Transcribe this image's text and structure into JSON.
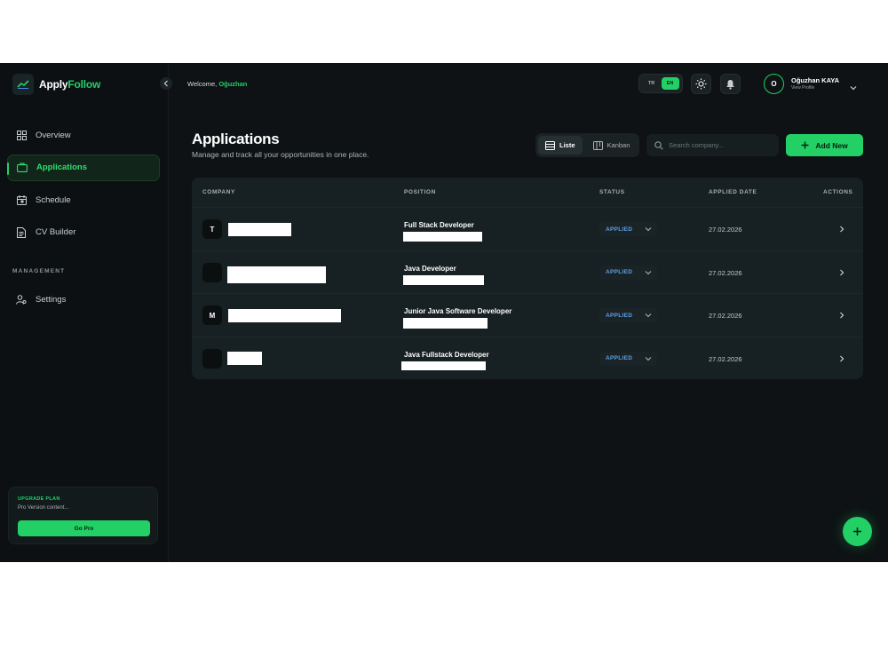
{
  "brand": {
    "part1": "Apply",
    "part2": "Follow",
    "accent": "#22d066"
  },
  "sidebar": {
    "items": [
      {
        "label": "Overview",
        "icon": "grid-icon"
      },
      {
        "label": "Applications",
        "icon": "briefcase-icon",
        "active": true
      },
      {
        "label": "Schedule",
        "icon": "calendar-icon"
      },
      {
        "label": "CV Builder",
        "icon": "document-icon"
      }
    ],
    "section_label": "MANAGEMENT",
    "management_items": [
      {
        "label": "Settings",
        "icon": "user-settings-icon"
      }
    ],
    "upgrade": {
      "title": "UPGRADE PLAN",
      "subtitle": "Pro Version content...",
      "button": "Go Pro"
    }
  },
  "topbar": {
    "welcome_prefix": "Welcome,",
    "welcome_name": "Oğuzhan",
    "lang_options": [
      "TR",
      "EN"
    ],
    "lang_selected": "EN",
    "user_initial": "O",
    "user_name": "Oğuzhan KAYA",
    "user_sub": "View Profile"
  },
  "main": {
    "title": "Applications",
    "subtitle": "Manage and track all your opportunities in one place.",
    "view_toggle": {
      "list": "Liste",
      "kanban": "Kanban",
      "selected": "Liste"
    },
    "search_placeholder": "Search company...",
    "add_button": "Add New"
  },
  "table": {
    "headers": {
      "company": "COMPANY",
      "position": "POSITION",
      "status": "STATUS",
      "applied_date": "APPLIED DATE",
      "actions": "ACTIONS"
    },
    "rows": [
      {
        "logo_initial": "T",
        "position": "Full Stack Developer",
        "status": "APPLIED",
        "date": "27.02.2026"
      },
      {
        "logo_initial": "",
        "position": "Java Developer",
        "status": "APPLIED",
        "date": "27.02.2026"
      },
      {
        "logo_initial": "M",
        "position": "Junior Java Software Developer",
        "status": "APPLIED",
        "date": "27.02.2026"
      },
      {
        "logo_initial": "",
        "position": "Java Fullstack Developer",
        "status": "APPLIED",
        "date": "27.02.2026"
      }
    ]
  }
}
